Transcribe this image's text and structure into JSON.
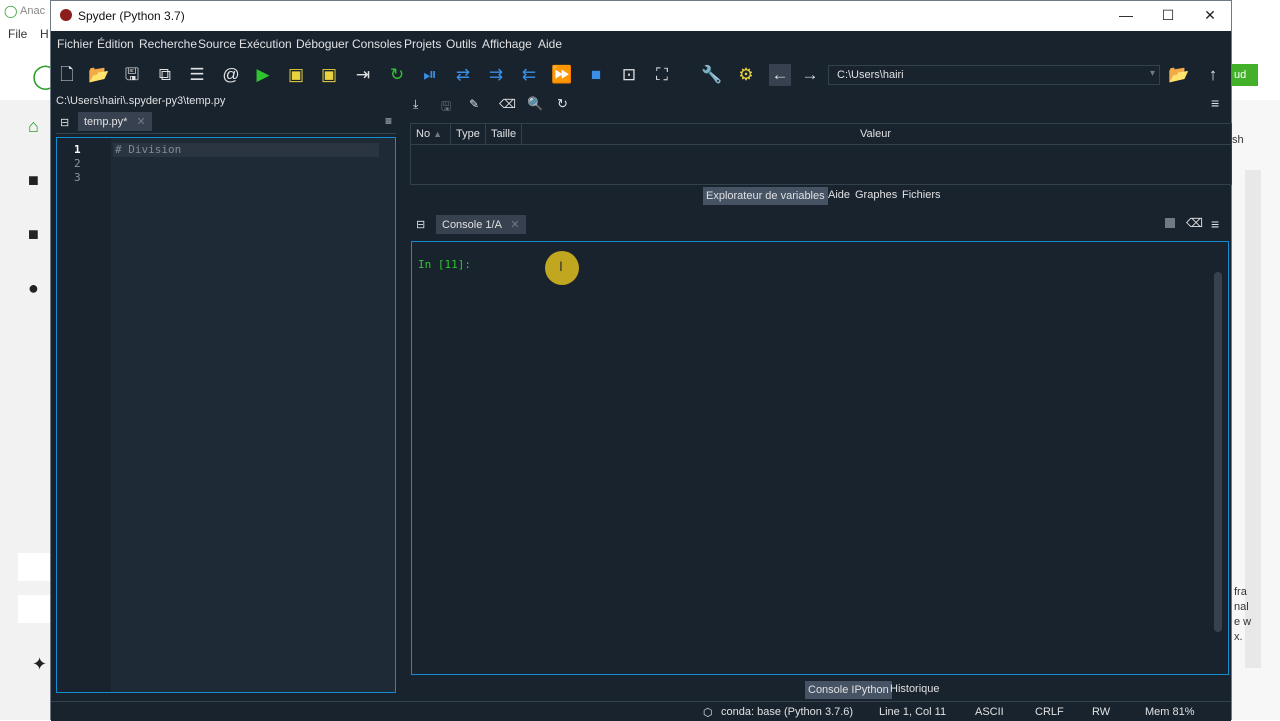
{
  "background_app": {
    "title_partial": "Anac",
    "menu": [
      "File",
      "H"
    ],
    "right_button_partial": "ud",
    "right_text_partial": [
      "sh",
      "fra",
      "nal",
      "e w",
      "x."
    ]
  },
  "window": {
    "title": "Spyder (Python 3.7)",
    "minimize": "—",
    "maximize": "☐",
    "close": "✕"
  },
  "menu": [
    "Fichier",
    "Édition",
    "Recherche",
    "Source",
    "Exécution",
    "Déboguer",
    "Consoles",
    "Projets",
    "Outils",
    "Affichage",
    "Aide"
  ],
  "toolbar": {
    "path": "C:\\Users\\hairi"
  },
  "editor": {
    "file_path": "C:\\Users\\hairi\\.spyder-py3\\temp.py",
    "tab_label": "temp.py*",
    "line_numbers": [
      "1",
      "2",
      "3"
    ],
    "code_line_1": "# Division"
  },
  "variable_explorer": {
    "columns": [
      "No",
      "Type",
      "Taille",
      "Valeur"
    ],
    "tabs": [
      "Explorateur de variables",
      "Aide",
      "Graphes",
      "Fichiers"
    ]
  },
  "console": {
    "tab_label": "Console 1/A",
    "prompt": "In [11]:",
    "tabs": [
      "Console IPython",
      "Historique"
    ]
  },
  "status": {
    "env": "conda: base (Python 3.7.6)",
    "position": "Line 1, Col 11",
    "encoding": "ASCII",
    "eol": "CRLF",
    "mode": "RW",
    "mem": "Mem 81%"
  },
  "colors": {
    "background": "#19232d",
    "accent": "#148cd2",
    "prompt": "#2fc52f"
  }
}
